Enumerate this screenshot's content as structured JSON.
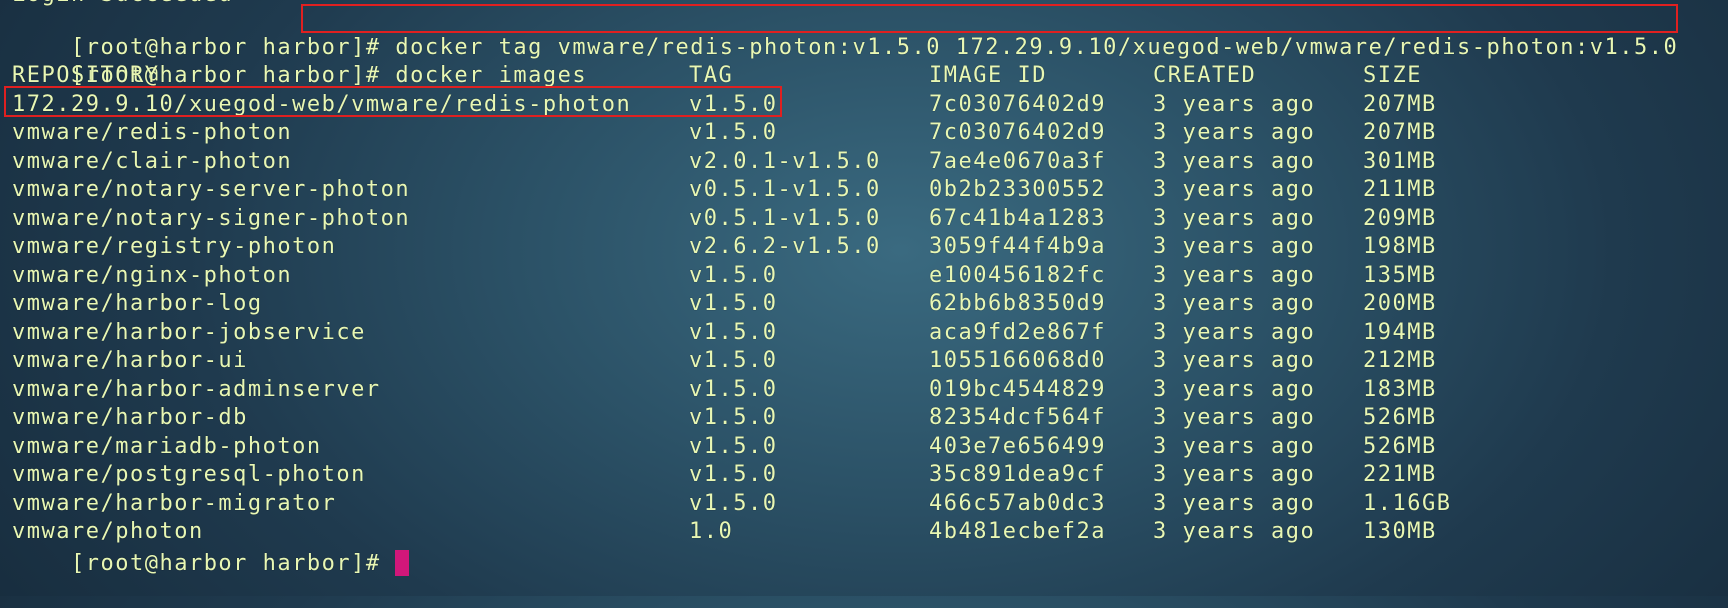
{
  "terminal": {
    "partial_top_line": "Login Succeeded",
    "prompt": "[root@harbor harbor]# ",
    "command_tag": "docker tag vmware/redis-photon:v1.5.0 172.29.9.10/xuegod-web/vmware/redis-photon:v1.5.0",
    "command_images": "docker images",
    "headers": {
      "repository": "REPOSITORY",
      "tag": "TAG",
      "image_id": "IMAGE ID",
      "created": "CREATED",
      "size": "SIZE"
    },
    "rows": [
      {
        "repository": "172.29.9.10/xuegod-web/vmware/redis-photon",
        "tag": "v1.5.0",
        "image_id": "7c03076402d9",
        "created": "3 years ago",
        "size": "207MB"
      },
      {
        "repository": "vmware/redis-photon",
        "tag": "v1.5.0",
        "image_id": "7c03076402d9",
        "created": "3 years ago",
        "size": "207MB"
      },
      {
        "repository": "vmware/clair-photon",
        "tag": "v2.0.1-v1.5.0",
        "image_id": "7ae4e0670a3f",
        "created": "3 years ago",
        "size": "301MB"
      },
      {
        "repository": "vmware/notary-server-photon",
        "tag": "v0.5.1-v1.5.0",
        "image_id": "0b2b23300552",
        "created": "3 years ago",
        "size": "211MB"
      },
      {
        "repository": "vmware/notary-signer-photon",
        "tag": "v0.5.1-v1.5.0",
        "image_id": "67c41b4a1283",
        "created": "3 years ago",
        "size": "209MB"
      },
      {
        "repository": "vmware/registry-photon",
        "tag": "v2.6.2-v1.5.0",
        "image_id": "3059f44f4b9a",
        "created": "3 years ago",
        "size": "198MB"
      },
      {
        "repository": "vmware/nginx-photon",
        "tag": "v1.5.0",
        "image_id": "e100456182fc",
        "created": "3 years ago",
        "size": "135MB"
      },
      {
        "repository": "vmware/harbor-log",
        "tag": "v1.5.0",
        "image_id": "62bb6b8350d9",
        "created": "3 years ago",
        "size": "200MB"
      },
      {
        "repository": "vmware/harbor-jobservice",
        "tag": "v1.5.0",
        "image_id": "aca9fd2e867f",
        "created": "3 years ago",
        "size": "194MB"
      },
      {
        "repository": "vmware/harbor-ui",
        "tag": "v1.5.0",
        "image_id": "1055166068d0",
        "created": "3 years ago",
        "size": "212MB"
      },
      {
        "repository": "vmware/harbor-adminserver",
        "tag": "v1.5.0",
        "image_id": "019bc4544829",
        "created": "3 years ago",
        "size": "183MB"
      },
      {
        "repository": "vmware/harbor-db",
        "tag": "v1.5.0",
        "image_id": "82354dcf564f",
        "created": "3 years ago",
        "size": "526MB"
      },
      {
        "repository": "vmware/mariadb-photon",
        "tag": "v1.5.0",
        "image_id": "403e7e656499",
        "created": "3 years ago",
        "size": "526MB"
      },
      {
        "repository": "vmware/postgresql-photon",
        "tag": "v1.5.0",
        "image_id": "35c891dea9cf",
        "created": "3 years ago",
        "size": "221MB"
      },
      {
        "repository": "vmware/harbor-migrator",
        "tag": "v1.5.0",
        "image_id": "466c57ab0dc3",
        "created": "3 years ago",
        "size": "1.16GB"
      },
      {
        "repository": "vmware/photon",
        "tag": "1.0",
        "image_id": "4b481ecbef2a",
        "created": "3 years ago",
        "size": "130MB"
      }
    ],
    "colors": {
      "text": "#e8f7b4",
      "cursor": "#d1177a",
      "highlight_box": "#e02020"
    }
  }
}
